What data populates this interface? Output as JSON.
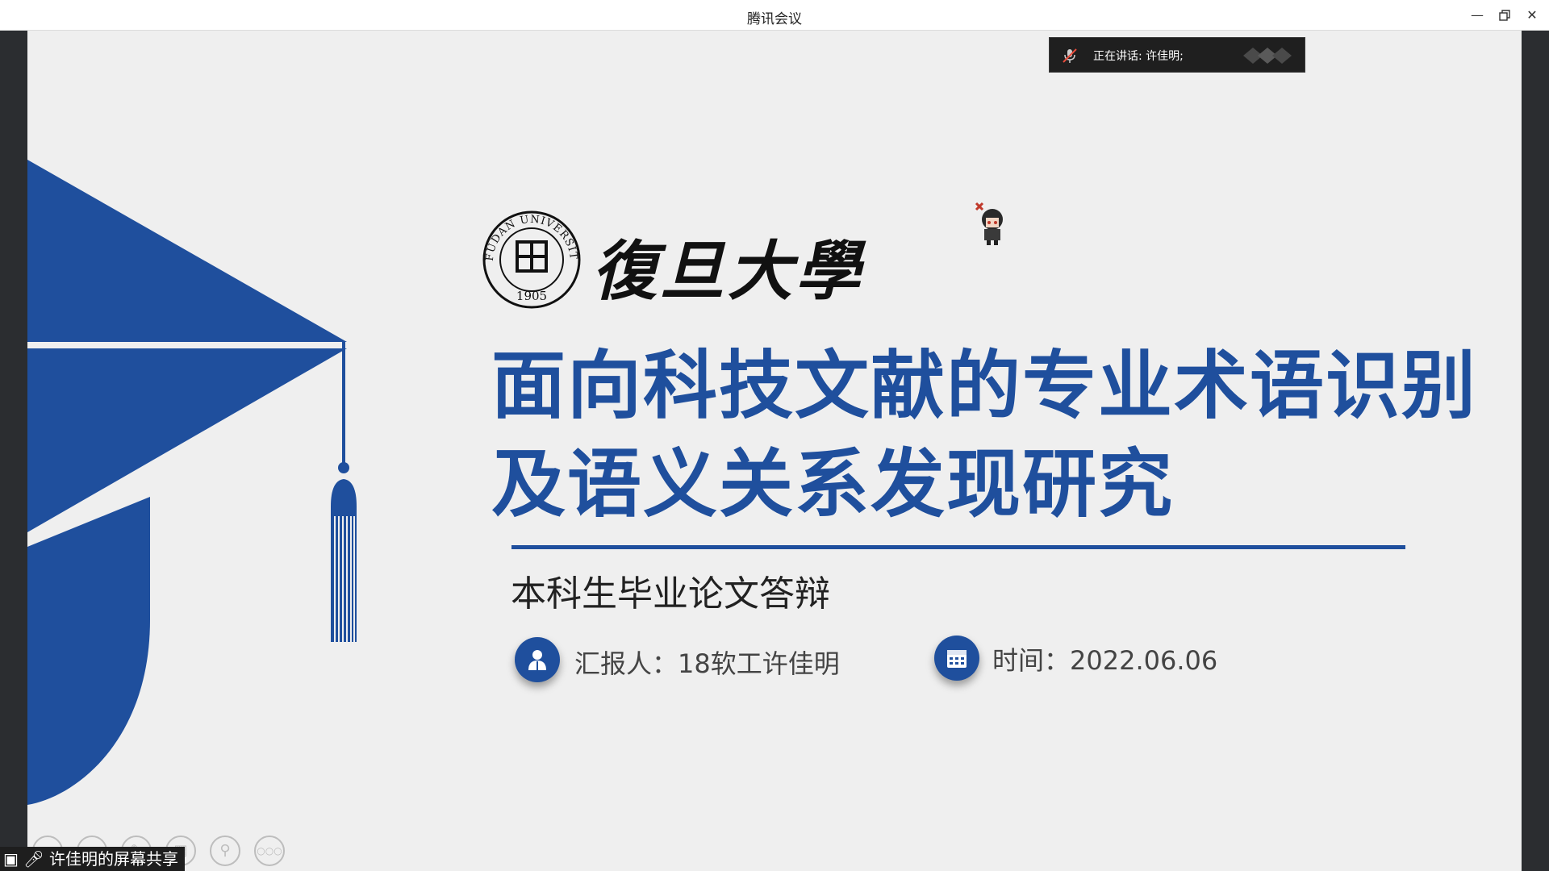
{
  "window": {
    "title": "腾讯会议",
    "controls": [
      "minimize-icon",
      "restore-icon",
      "close-icon"
    ]
  },
  "speaker_bar": {
    "text": "正在讲话: 许佳明;",
    "icon": "muted-mic-icon"
  },
  "slide": {
    "university_seal_text": "FUDAN UNIVERSITY 1905",
    "university_name": "復旦大學",
    "title_line1": "面向科技文献的专业术语识别",
    "title_line2": "及语义关系发现研究",
    "subtitle": "本科生毕业论文答辩",
    "presenter": "汇报人：18软工许佳明",
    "date": "时间：2022.06.06",
    "accent_color": "#1f4f9d"
  },
  "slideshow_toolbar": {
    "buttons": [
      "prev-icon",
      "next-icon",
      "pen-icon",
      "slides-grid-icon",
      "zoom-icon",
      "more-icon"
    ]
  },
  "share_status": {
    "text": "许佳明的屏幕共享"
  }
}
